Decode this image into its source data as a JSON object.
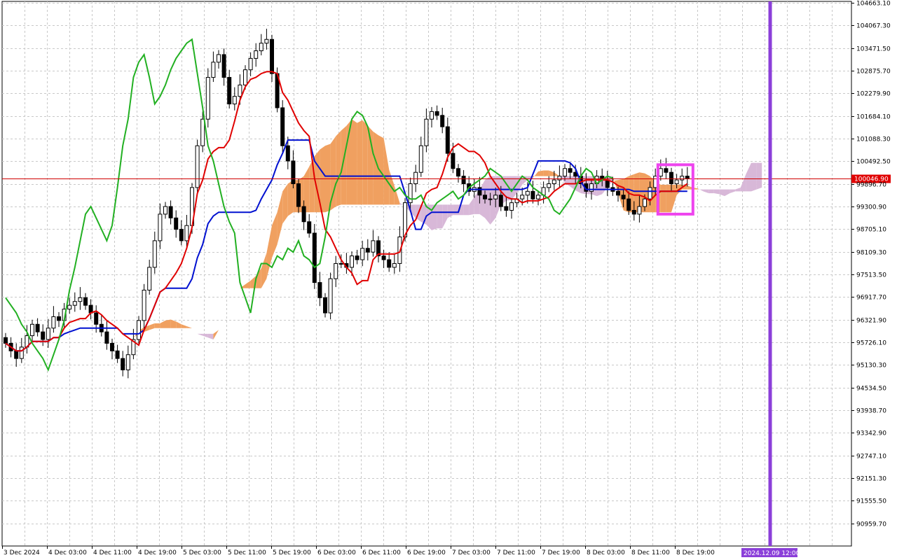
{
  "chart_data": {
    "type": "candlestick",
    "indicator": "Ichimoku Kinko Hyo",
    "symbol_current_price": "100046.90",
    "crosshair_time_label": "2024.12.09 12:00",
    "y_ticks": [
      "104663.10",
      "104067.30",
      "103471.50",
      "102875.70",
      "102279.90",
      "101684.10",
      "101088.30",
      "100492.50",
      "99896.70",
      "99300.90",
      "98705.10",
      "98109.30",
      "97513.50",
      "96917.70",
      "96321.90",
      "95726.10",
      "95130.30",
      "94534.50",
      "93938.70",
      "93342.90",
      "92747.10",
      "92151.30",
      "91555.50",
      "90959.70"
    ],
    "ylim": [
      90364.0,
      104700.0
    ],
    "x_ticks": [
      "3 Dec 2024",
      "4 Dec 03:00",
      "4 Dec 11:00",
      "4 Dec 19:00",
      "5 Dec 03:00",
      "5 Dec 11:00",
      "5 Dec 19:00",
      "6 Dec 03:00",
      "6 Dec 11:00",
      "6 Dec 19:00",
      "7 Dec 03:00",
      "7 Dec 11:00",
      "7 Dec 19:00",
      "8 Dec 03:00",
      "8 Dec 11:00",
      "8 Dec 19:00"
    ],
    "colors": {
      "tenkan": "#e00000",
      "kijun": "#0010d0",
      "chikou": "#22b022",
      "cloud_bull": "#f0a060",
      "cloud_bear": "#d8b8d8",
      "current_price_line": "#d00000",
      "price_tag": "#e00000",
      "vertical_marker": "#8b3fd9",
      "highlight_box": "#ee44ee"
    },
    "candles_close": [
      95700,
      95500,
      95300,
      95600,
      95900,
      96200,
      96000,
      95800,
      96100,
      96400,
      96300,
      96600,
      96700,
      96800,
      96900,
      96700,
      96500,
      96200,
      96000,
      95700,
      95500,
      95300,
      95000,
      95400,
      95800,
      96300,
      97100,
      97700,
      98400,
      99100,
      99300,
      99000,
      98700,
      98400,
      98800,
      99800,
      100900,
      101600,
      102700,
      103100,
      103300,
      102700,
      102000,
      102200,
      102500,
      102900,
      103200,
      103400,
      103600,
      103700,
      102800,
      101900,
      100900,
      100500,
      99900,
      99300,
      98900,
      98600,
      97300,
      96900,
      96500,
      97400,
      97800,
      97800,
      97700,
      98000,
      97900,
      98200,
      98100,
      98400,
      98000,
      97900,
      97700,
      97800,
      98500,
      99400,
      99900,
      100200,
      100900,
      101600,
      101800,
      101700,
      101400,
      100700,
      100300,
      100100,
      99900,
      99700,
      99800,
      99600,
      99500,
      99500,
      99600,
      99300,
      99200,
      99400,
      99500,
      99600,
      99700,
      99500,
      99600,
      99800,
      99900,
      100000,
      100100,
      100300,
      100200,
      100100,
      99900,
      99700,
      99900,
      100100,
      100000,
      99800,
      99700,
      99600,
      99500,
      99200,
      99100,
      99300,
      99500,
      99800,
      100100,
      100300,
      100200,
      99900,
      100000,
      100100,
      100046.9
    ]
  }
}
